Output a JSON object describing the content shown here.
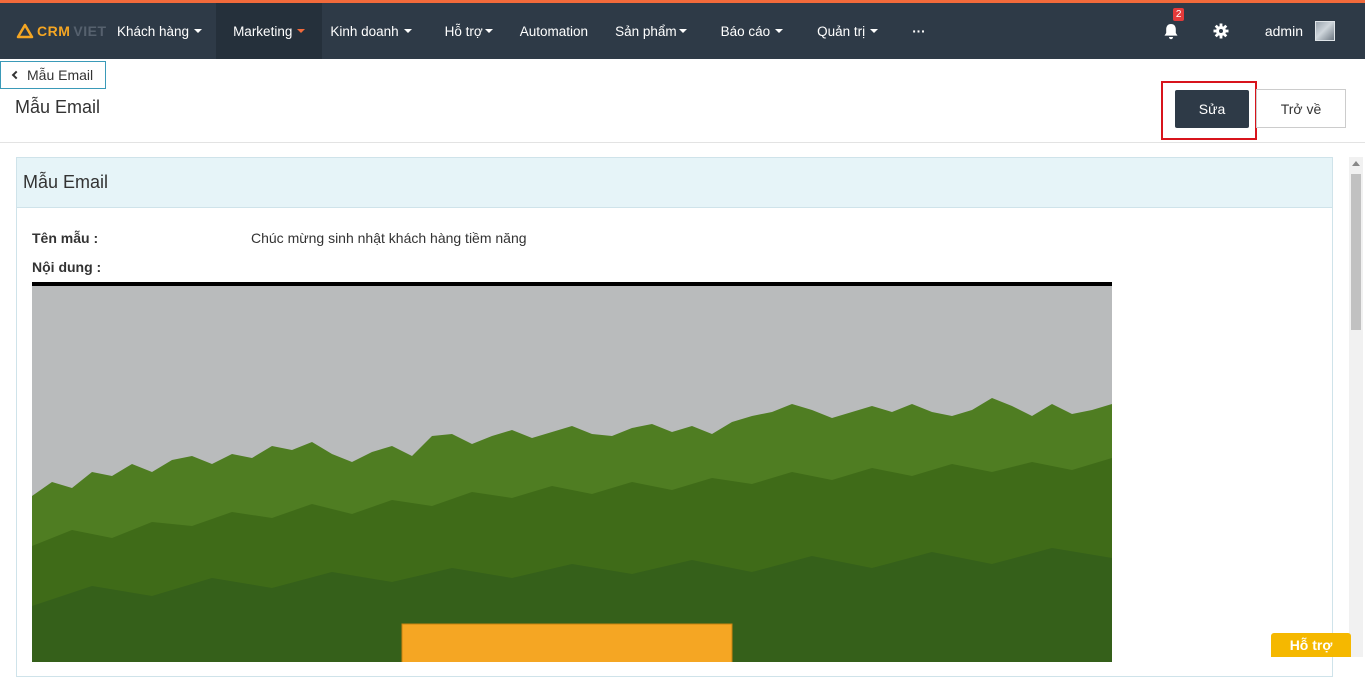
{
  "app": {
    "logo_crm": "CRM",
    "logo_viet": "VIET"
  },
  "nav": {
    "items": [
      {
        "label": "Khách hàng",
        "caret": true
      },
      {
        "label": "Marketing",
        "caret": true,
        "active": true
      },
      {
        "label": "Kinh doanh",
        "caret": true
      },
      {
        "label": "Hỗ trợ",
        "caret": true
      },
      {
        "label": "Automation",
        "caret": false
      },
      {
        "label": "Sản phẩm",
        "caret": true
      },
      {
        "label": "Báo cáo",
        "caret": true
      },
      {
        "label": "Quản trị",
        "caret": true
      }
    ],
    "more_label": "···",
    "notification_count": "2",
    "user_name": "admin"
  },
  "breadcrumb": {
    "label": "Mẫu Email"
  },
  "page": {
    "title": "Mẫu Email"
  },
  "actions": {
    "edit_label": "Sửa",
    "back_label": "Trở về"
  },
  "panel": {
    "title": "Mẫu Email",
    "fields": [
      {
        "label": "Tên mẫu :",
        "value": "Chúc mừng sinh nhật khách hàng tiềm năng"
      },
      {
        "label": "Nội dung :",
        "value": ""
      }
    ]
  },
  "help_button": {
    "label": "Hỗ trợ"
  },
  "colors": {
    "navbar": "#2e3a47",
    "accent": "#f26a3b",
    "highlight_border": "#d8141c",
    "help": "#f5b800",
    "panel_head": "#e6f4f8"
  },
  "icons": {
    "bell": "bell-icon",
    "gear": "gear-icon",
    "back": "chevron-left-icon",
    "more": "ellipsis-icon"
  }
}
